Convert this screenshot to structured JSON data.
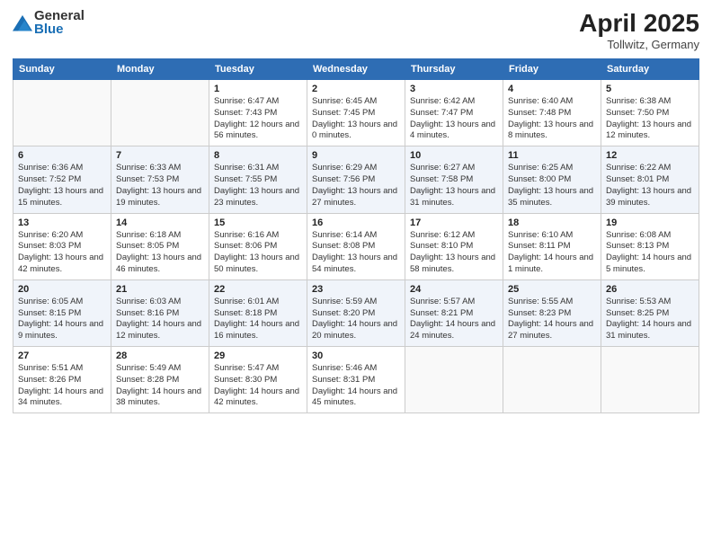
{
  "logo": {
    "general": "General",
    "blue": "Blue"
  },
  "title": "April 2025",
  "subtitle": "Tollwitz, Germany",
  "headers": [
    "Sunday",
    "Monday",
    "Tuesday",
    "Wednesday",
    "Thursday",
    "Friday",
    "Saturday"
  ],
  "weeks": [
    [
      {
        "day": "",
        "info": ""
      },
      {
        "day": "",
        "info": ""
      },
      {
        "day": "1",
        "info": "Sunrise: 6:47 AM\nSunset: 7:43 PM\nDaylight: 12 hours and 56 minutes."
      },
      {
        "day": "2",
        "info": "Sunrise: 6:45 AM\nSunset: 7:45 PM\nDaylight: 13 hours and 0 minutes."
      },
      {
        "day": "3",
        "info": "Sunrise: 6:42 AM\nSunset: 7:47 PM\nDaylight: 13 hours and 4 minutes."
      },
      {
        "day": "4",
        "info": "Sunrise: 6:40 AM\nSunset: 7:48 PM\nDaylight: 13 hours and 8 minutes."
      },
      {
        "day": "5",
        "info": "Sunrise: 6:38 AM\nSunset: 7:50 PM\nDaylight: 13 hours and 12 minutes."
      }
    ],
    [
      {
        "day": "6",
        "info": "Sunrise: 6:36 AM\nSunset: 7:52 PM\nDaylight: 13 hours and 15 minutes."
      },
      {
        "day": "7",
        "info": "Sunrise: 6:33 AM\nSunset: 7:53 PM\nDaylight: 13 hours and 19 minutes."
      },
      {
        "day": "8",
        "info": "Sunrise: 6:31 AM\nSunset: 7:55 PM\nDaylight: 13 hours and 23 minutes."
      },
      {
        "day": "9",
        "info": "Sunrise: 6:29 AM\nSunset: 7:56 PM\nDaylight: 13 hours and 27 minutes."
      },
      {
        "day": "10",
        "info": "Sunrise: 6:27 AM\nSunset: 7:58 PM\nDaylight: 13 hours and 31 minutes."
      },
      {
        "day": "11",
        "info": "Sunrise: 6:25 AM\nSunset: 8:00 PM\nDaylight: 13 hours and 35 minutes."
      },
      {
        "day": "12",
        "info": "Sunrise: 6:22 AM\nSunset: 8:01 PM\nDaylight: 13 hours and 39 minutes."
      }
    ],
    [
      {
        "day": "13",
        "info": "Sunrise: 6:20 AM\nSunset: 8:03 PM\nDaylight: 13 hours and 42 minutes."
      },
      {
        "day": "14",
        "info": "Sunrise: 6:18 AM\nSunset: 8:05 PM\nDaylight: 13 hours and 46 minutes."
      },
      {
        "day": "15",
        "info": "Sunrise: 6:16 AM\nSunset: 8:06 PM\nDaylight: 13 hours and 50 minutes."
      },
      {
        "day": "16",
        "info": "Sunrise: 6:14 AM\nSunset: 8:08 PM\nDaylight: 13 hours and 54 minutes."
      },
      {
        "day": "17",
        "info": "Sunrise: 6:12 AM\nSunset: 8:10 PM\nDaylight: 13 hours and 58 minutes."
      },
      {
        "day": "18",
        "info": "Sunrise: 6:10 AM\nSunset: 8:11 PM\nDaylight: 14 hours and 1 minute."
      },
      {
        "day": "19",
        "info": "Sunrise: 6:08 AM\nSunset: 8:13 PM\nDaylight: 14 hours and 5 minutes."
      }
    ],
    [
      {
        "day": "20",
        "info": "Sunrise: 6:05 AM\nSunset: 8:15 PM\nDaylight: 14 hours and 9 minutes."
      },
      {
        "day": "21",
        "info": "Sunrise: 6:03 AM\nSunset: 8:16 PM\nDaylight: 14 hours and 12 minutes."
      },
      {
        "day": "22",
        "info": "Sunrise: 6:01 AM\nSunset: 8:18 PM\nDaylight: 14 hours and 16 minutes."
      },
      {
        "day": "23",
        "info": "Sunrise: 5:59 AM\nSunset: 8:20 PM\nDaylight: 14 hours and 20 minutes."
      },
      {
        "day": "24",
        "info": "Sunrise: 5:57 AM\nSunset: 8:21 PM\nDaylight: 14 hours and 24 minutes."
      },
      {
        "day": "25",
        "info": "Sunrise: 5:55 AM\nSunset: 8:23 PM\nDaylight: 14 hours and 27 minutes."
      },
      {
        "day": "26",
        "info": "Sunrise: 5:53 AM\nSunset: 8:25 PM\nDaylight: 14 hours and 31 minutes."
      }
    ],
    [
      {
        "day": "27",
        "info": "Sunrise: 5:51 AM\nSunset: 8:26 PM\nDaylight: 14 hours and 34 minutes."
      },
      {
        "day": "28",
        "info": "Sunrise: 5:49 AM\nSunset: 8:28 PM\nDaylight: 14 hours and 38 minutes."
      },
      {
        "day": "29",
        "info": "Sunrise: 5:47 AM\nSunset: 8:30 PM\nDaylight: 14 hours and 42 minutes."
      },
      {
        "day": "30",
        "info": "Sunrise: 5:46 AM\nSunset: 8:31 PM\nDaylight: 14 hours and 45 minutes."
      },
      {
        "day": "",
        "info": ""
      },
      {
        "day": "",
        "info": ""
      },
      {
        "day": "",
        "info": ""
      }
    ]
  ]
}
